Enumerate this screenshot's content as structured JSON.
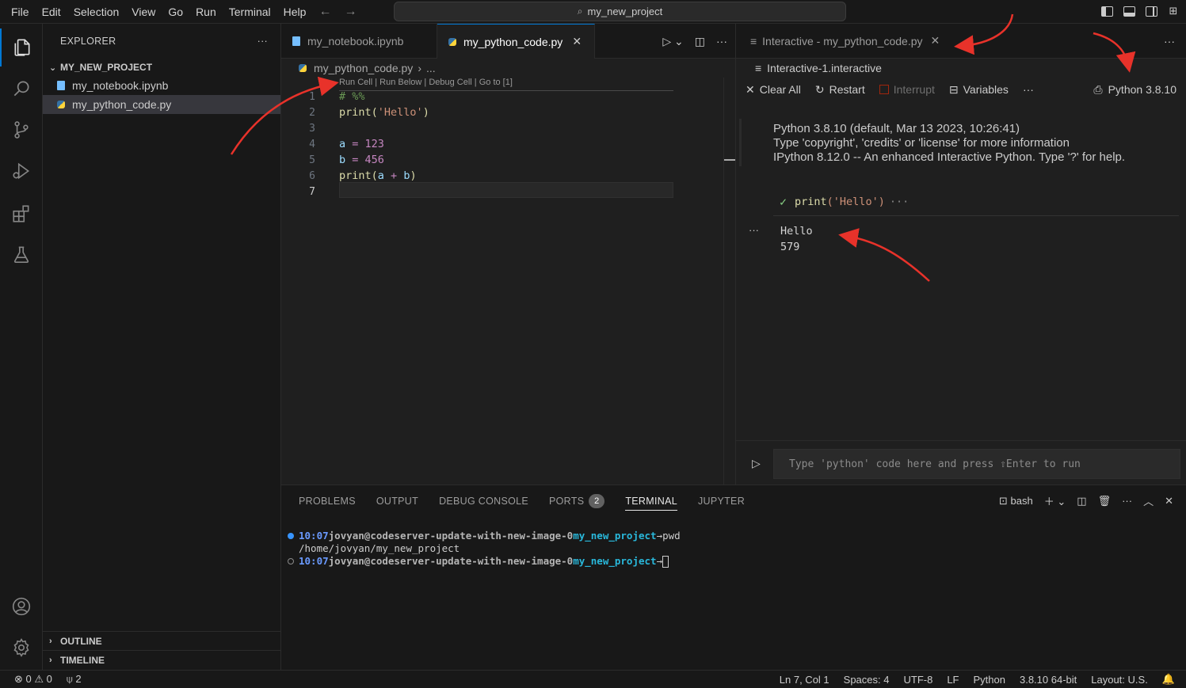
{
  "menubar": {
    "items": [
      "File",
      "Edit",
      "Selection",
      "View",
      "Go",
      "Run",
      "Terminal",
      "Help"
    ],
    "command_center": "my_new_project"
  },
  "sidebar": {
    "title": "EXPLORER",
    "project": "MY_NEW_PROJECT",
    "files": [
      "my_notebook.ipynb",
      "my_python_code.py"
    ],
    "outline": "OUTLINE",
    "timeline": "TIMELINE"
  },
  "editor": {
    "tabs": [
      {
        "label": "my_notebook.ipynb"
      },
      {
        "label": "my_python_code.py"
      }
    ],
    "breadcrumb_file": "my_python_code.py",
    "breadcrumb_more": "...",
    "codelens": "Run Cell | Run Below | Debug Cell | Go to [1]",
    "line_numbers": [
      "1",
      "2",
      "3",
      "4",
      "5",
      "6",
      "7"
    ],
    "code": {
      "l1": "# %%",
      "l2_fn": "print",
      "l2_open": "(",
      "l2_str": "'Hello'",
      "l2_close": ")",
      "l4_var": "a",
      "l4_op": " = ",
      "l4_val": "123",
      "l5_var": "b",
      "l5_op": " = ",
      "l5_val": "456",
      "l6_fn": "print",
      "l6_open": "(",
      "l6_a": "a",
      "l6_op": " + ",
      "l6_b": "b",
      "l6_close": ")"
    }
  },
  "interactive": {
    "tab_label": "Interactive - my_python_code.py",
    "breadcrumb": "Interactive-1.interactive",
    "toolbar": {
      "clear_all": "Clear All",
      "restart": "Restart",
      "interrupt": "Interrupt",
      "variables": "Variables",
      "more": "···"
    },
    "kernel": "Python 3.8.10",
    "banner": [
      "Python 3.8.10 (default, Mar 13 2023, 10:26:41)",
      "Type 'copyright', 'credits' or 'license' for more information",
      "IPython 8.12.0 -- An enhanced Interactive Python. Type '?' for help."
    ],
    "executed_cell_fn": "print",
    "executed_cell_str": "('Hello')",
    "executed_cell_more": "···",
    "output_lines": [
      "Hello",
      "579"
    ],
    "input_placeholder": "Type 'python' code here and press ⇧Enter to run"
  },
  "panel": {
    "tabs": [
      "PROBLEMS",
      "OUTPUT",
      "DEBUG CONSOLE",
      "PORTS",
      "TERMINAL",
      "JUPYTER"
    ],
    "ports_badge": "2",
    "shell": "bash",
    "terminal": {
      "line1_time": "10:07",
      "line1_host": "jovyan@codeserver-update-with-new-image-0",
      "line1_project": "my_new_project",
      "line1_arrow": "→",
      "line1_cmd": "pwd",
      "line2_output": "/home/jovyan/my_new_project",
      "line3_time": "10:07",
      "line3_host": "jovyan@codeserver-update-with-new-image-0",
      "line3_project": "my_new_project",
      "line3_arrow": "→"
    }
  },
  "statusbar": {
    "errors": "0",
    "warnings": "0",
    "ports": "2",
    "position": "Ln 7, Col 1",
    "spaces": "Spaces: 4",
    "encoding": "UTF-8",
    "eol": "LF",
    "language": "Python",
    "interpreter": "3.8.10 64-bit",
    "layout": "Layout: U.S."
  },
  "colors": {
    "accent": "#0078d4",
    "annotation_arrow": "#e8322a",
    "success_check": "#89d185"
  }
}
